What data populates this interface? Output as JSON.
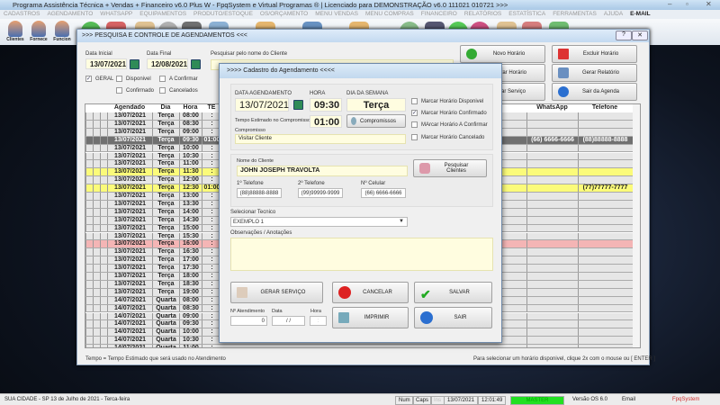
{
  "window": {
    "title": "Programa Assistência Técnica + Vendas + Financeiro v6.0 Plus W - FpqSystem e Virtual Programas ® | Licenciado para  DEMONSTRAÇÃO v6.0 111021 010721 >>>",
    "min": "–",
    "max": "▫",
    "close": "✕"
  },
  "menu": [
    "CADASTROS",
    "AGENDAMENTO",
    "WHATSAPP",
    "EQUIPAMENTOS",
    "PRODUTO/ESTOQUE",
    "OS/ORÇAMENTO",
    "MENU VENDAS",
    "MENU COMPRAS",
    "FINANCEIRO",
    "RELATÓRIOS",
    "ESTATÍSTICA",
    "FERRAMENTAS",
    "AJUDA"
  ],
  "menu_email": "E-MAIL",
  "toolbar": {
    "clientes": "Clientes",
    "fornece": "Fornece",
    "funcion": "Funcion"
  },
  "agenda": {
    "title": ">>> PESQUISA E CONTROLE DE AGENDAMENTOS <<<",
    "help": "?",
    "close": "✕",
    "data_inicial_label": "Data Inicial",
    "data_inicial": "13/07/2021",
    "data_final_label": "Data Final",
    "data_final": "12/08/2021",
    "search_label": "Pesquisar pelo nome do Cliente",
    "search_value": "",
    "filters": [
      {
        "label": "GERAL",
        "checked": true
      },
      {
        "label": "Disponivel",
        "checked": false
      },
      {
        "label": "A Confirmar",
        "checked": false
      },
      {
        "label": "Confirmado",
        "checked": false
      },
      {
        "label": "Cancelados",
        "checked": false
      }
    ],
    "buttons": {
      "novo": "Novo Horário",
      "excluir": "Excluir Horário",
      "alterar": "Alterar Horário",
      "relatorio": "Gerar Relatório",
      "servico": "Gerar Serviço",
      "sair": "Sair da Agenda"
    },
    "columns": {
      "agendado": "Agendado",
      "dia": "Dia",
      "hora": "Hora",
      "te": "TE",
      "whatsapp": "WhatsApp",
      "telefone": "Telefone"
    },
    "rows": [
      {
        "d": "13/07/2021",
        "dia": "Terça",
        "h": "08:00",
        "te": ":",
        "w": "",
        "t": "",
        "s": ""
      },
      {
        "d": "13/07/2021",
        "dia": "Terça",
        "h": "08:30",
        "te": ":",
        "w": "",
        "t": "",
        "s": ""
      },
      {
        "d": "13/07/2021",
        "dia": "Terça",
        "h": "09:00",
        "te": ":",
        "w": "",
        "t": "",
        "s": ""
      },
      {
        "d": "13/07/2021",
        "dia": "Terça",
        "h": "09:30",
        "te": "01:00",
        "w": "(66) 6666-6666",
        "t": "(88)88888-8888",
        "s": "sel"
      },
      {
        "d": "13/07/2021",
        "dia": "Terça",
        "h": "10:00",
        "te": ":",
        "w": "",
        "t": "",
        "s": ""
      },
      {
        "d": "13/07/2021",
        "dia": "Terça",
        "h": "10:30",
        "te": ":",
        "w": "",
        "t": "",
        "s": ""
      },
      {
        "d": "13/07/2021",
        "dia": "Terça",
        "h": "11:00",
        "te": ":",
        "w": "",
        "t": "",
        "s": ""
      },
      {
        "d": "13/07/2021",
        "dia": "Terça",
        "h": "11:30",
        "te": ":",
        "w": "",
        "t": "",
        "s": "yel"
      },
      {
        "d": "13/07/2021",
        "dia": "Terça",
        "h": "12:00",
        "te": ":",
        "w": "",
        "t": "",
        "s": ""
      },
      {
        "d": "13/07/2021",
        "dia": "Terça",
        "h": "12:30",
        "te": "01:00",
        "w": "",
        "t": "(77)77777-7777",
        "s": "yel"
      },
      {
        "d": "13/07/2021",
        "dia": "Terça",
        "h": "13:00",
        "te": ":",
        "w": "",
        "t": "",
        "s": ""
      },
      {
        "d": "13/07/2021",
        "dia": "Terça",
        "h": "13:30",
        "te": ":",
        "w": "",
        "t": "",
        "s": ""
      },
      {
        "d": "13/07/2021",
        "dia": "Terça",
        "h": "14:00",
        "te": ":",
        "w": "",
        "t": "",
        "s": ""
      },
      {
        "d": "13/07/2021",
        "dia": "Terça",
        "h": "14:30",
        "te": ":",
        "w": "",
        "t": "",
        "s": ""
      },
      {
        "d": "13/07/2021",
        "dia": "Terça",
        "h": "15:00",
        "te": ":",
        "w": "",
        "t": "",
        "s": ""
      },
      {
        "d": "13/07/2021",
        "dia": "Terça",
        "h": "15:30",
        "te": ":",
        "w": "",
        "t": "",
        "s": ""
      },
      {
        "d": "13/07/2021",
        "dia": "Terça",
        "h": "16:00",
        "te": ":",
        "w": "",
        "t": "",
        "s": "red"
      },
      {
        "d": "13/07/2021",
        "dia": "Terça",
        "h": "16:30",
        "te": ":",
        "w": "",
        "t": "",
        "s": ""
      },
      {
        "d": "13/07/2021",
        "dia": "Terça",
        "h": "17:00",
        "te": ":",
        "w": "",
        "t": "",
        "s": ""
      },
      {
        "d": "13/07/2021",
        "dia": "Terça",
        "h": "17:30",
        "te": ":",
        "w": "",
        "t": "",
        "s": ""
      },
      {
        "d": "13/07/2021",
        "dia": "Terça",
        "h": "18:00",
        "te": ":",
        "w": "",
        "t": "",
        "s": ""
      },
      {
        "d": "13/07/2021",
        "dia": "Terça",
        "h": "18:30",
        "te": ":",
        "w": "",
        "t": "",
        "s": ""
      },
      {
        "d": "13/07/2021",
        "dia": "Terça",
        "h": "19:00",
        "te": ":",
        "w": "",
        "t": "",
        "s": ""
      },
      {
        "d": "14/07/2021",
        "dia": "Quarta",
        "h": "08:00",
        "te": ":",
        "w": "",
        "t": "",
        "s": ""
      },
      {
        "d": "14/07/2021",
        "dia": "Quarta",
        "h": "08:30",
        "te": ":",
        "w": "",
        "t": "",
        "s": ""
      },
      {
        "d": "14/07/2021",
        "dia": "Quarta",
        "h": "09:00",
        "te": ":",
        "w": "",
        "t": "",
        "s": ""
      },
      {
        "d": "14/07/2021",
        "dia": "Quarta",
        "h": "09:30",
        "te": ":",
        "w": "",
        "t": "",
        "s": ""
      },
      {
        "d": "14/07/2021",
        "dia": "Quarta",
        "h": "10:00",
        "te": ":",
        "w": "",
        "t": "",
        "s": ""
      },
      {
        "d": "14/07/2021",
        "dia": "Quarta",
        "h": "10:30",
        "te": ":",
        "w": "",
        "t": "",
        "s": ""
      },
      {
        "d": "14/07/2021",
        "dia": "Quarta",
        "h": "11:00",
        "te": ":",
        "w": "",
        "t": "",
        "s": ""
      }
    ],
    "footer_left": "Tempo = Tempo Estimado que será usado no Atendimento",
    "footer_right": "Para selecionar um horário disponivel, clique 2x com o mouse ou [ ENTER ]"
  },
  "dialog": {
    "title": ">>>>  Cadastro do Agendamento  <<<<",
    "data_label": "DATA AGENDAMENTO",
    "data": "13/07/2021",
    "hora_label": "HORA",
    "hora": "09:30",
    "dia_label": "DIA DA SEMANA",
    "dia": "Terça",
    "tempo_label": "Tempo Estimado no Compromisso",
    "tempo": "01:00",
    "compromissos_btn": "Compromissos",
    "compromisso_label": "Compromisso",
    "compromisso": "Visitar Cliente",
    "status": [
      {
        "label": "Marcar Horário Disponivel",
        "checked": false
      },
      {
        "label": "Marcar Horário Confirmado",
        "checked": true
      },
      {
        "label": "MArcar Horário A Confirmar",
        "checked": false
      },
      {
        "label": "Marcar Horário Cancelado",
        "checked": false
      }
    ],
    "cliente_label": "Nome do Cliente",
    "cliente": "JOHN JOSEPH TRAVOLTA",
    "pesquisar_btn": "Pesquisar Clientes",
    "tel1_label": "1º Telefone",
    "tel1": "(88)88888-8888",
    "tel2_label": "2º Telefone",
    "tel2": "(99)99999-9999",
    "cel_label": "Nº Celular",
    "cel": "(66) 6666-6666",
    "tecnico_label": "Selecionar Tecnico",
    "tecnico": "EXEMPLO 1",
    "obs_label": "Observações  / Anotações",
    "obs": "",
    "gerar_btn": "GERAR  SERVIÇO",
    "cancelar_btn": "CANCELAR",
    "salvar_btn": "SALVAR",
    "imprimir_btn": "IMPRIMIR",
    "sair_btn": "SAIR",
    "atend_label": "Nº Atendimento",
    "atend": "0",
    "data2_label": "Data",
    "data2": "/  /",
    "hora2_label": "Hora",
    "hora2": ":"
  },
  "status": {
    "cidade": "SUA CIDADE - SP 13 de Julho de 2021 - Terca-feira",
    "num": "Num",
    "caps": "Caps",
    "ins": "Ins",
    "date": "13/07/2021",
    "time": "12:01:49",
    "user": "MASTER",
    "versao": "Versão OS 6.0",
    "email": "Email",
    "brand": "FpqSystem"
  },
  "colors": {
    "selected_row": "#707070",
    "confirm_row": "#fbfb7a",
    "cancel_row": "#f4b5b5",
    "master": "#22e022",
    "brand": "#d03030"
  }
}
